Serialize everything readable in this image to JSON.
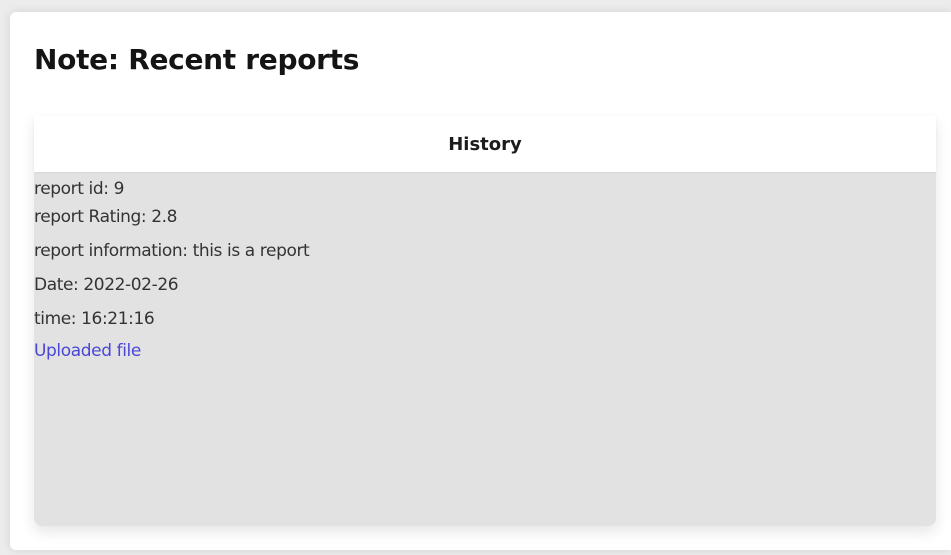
{
  "note": {
    "title": "Note: Recent reports"
  },
  "history": {
    "header": "History",
    "lines": [
      "report id: 9",
      "report Rating: 2.8",
      "report information: this is a report",
      "Date: 2022-02-26",
      "time: 16:21:16"
    ],
    "file_link_label": "Uploaded file"
  },
  "colors": {
    "link": "#4a46d6",
    "panel_background": "#e2e2e2",
    "header_background": "#ffffff",
    "page_background": "#ececec"
  }
}
